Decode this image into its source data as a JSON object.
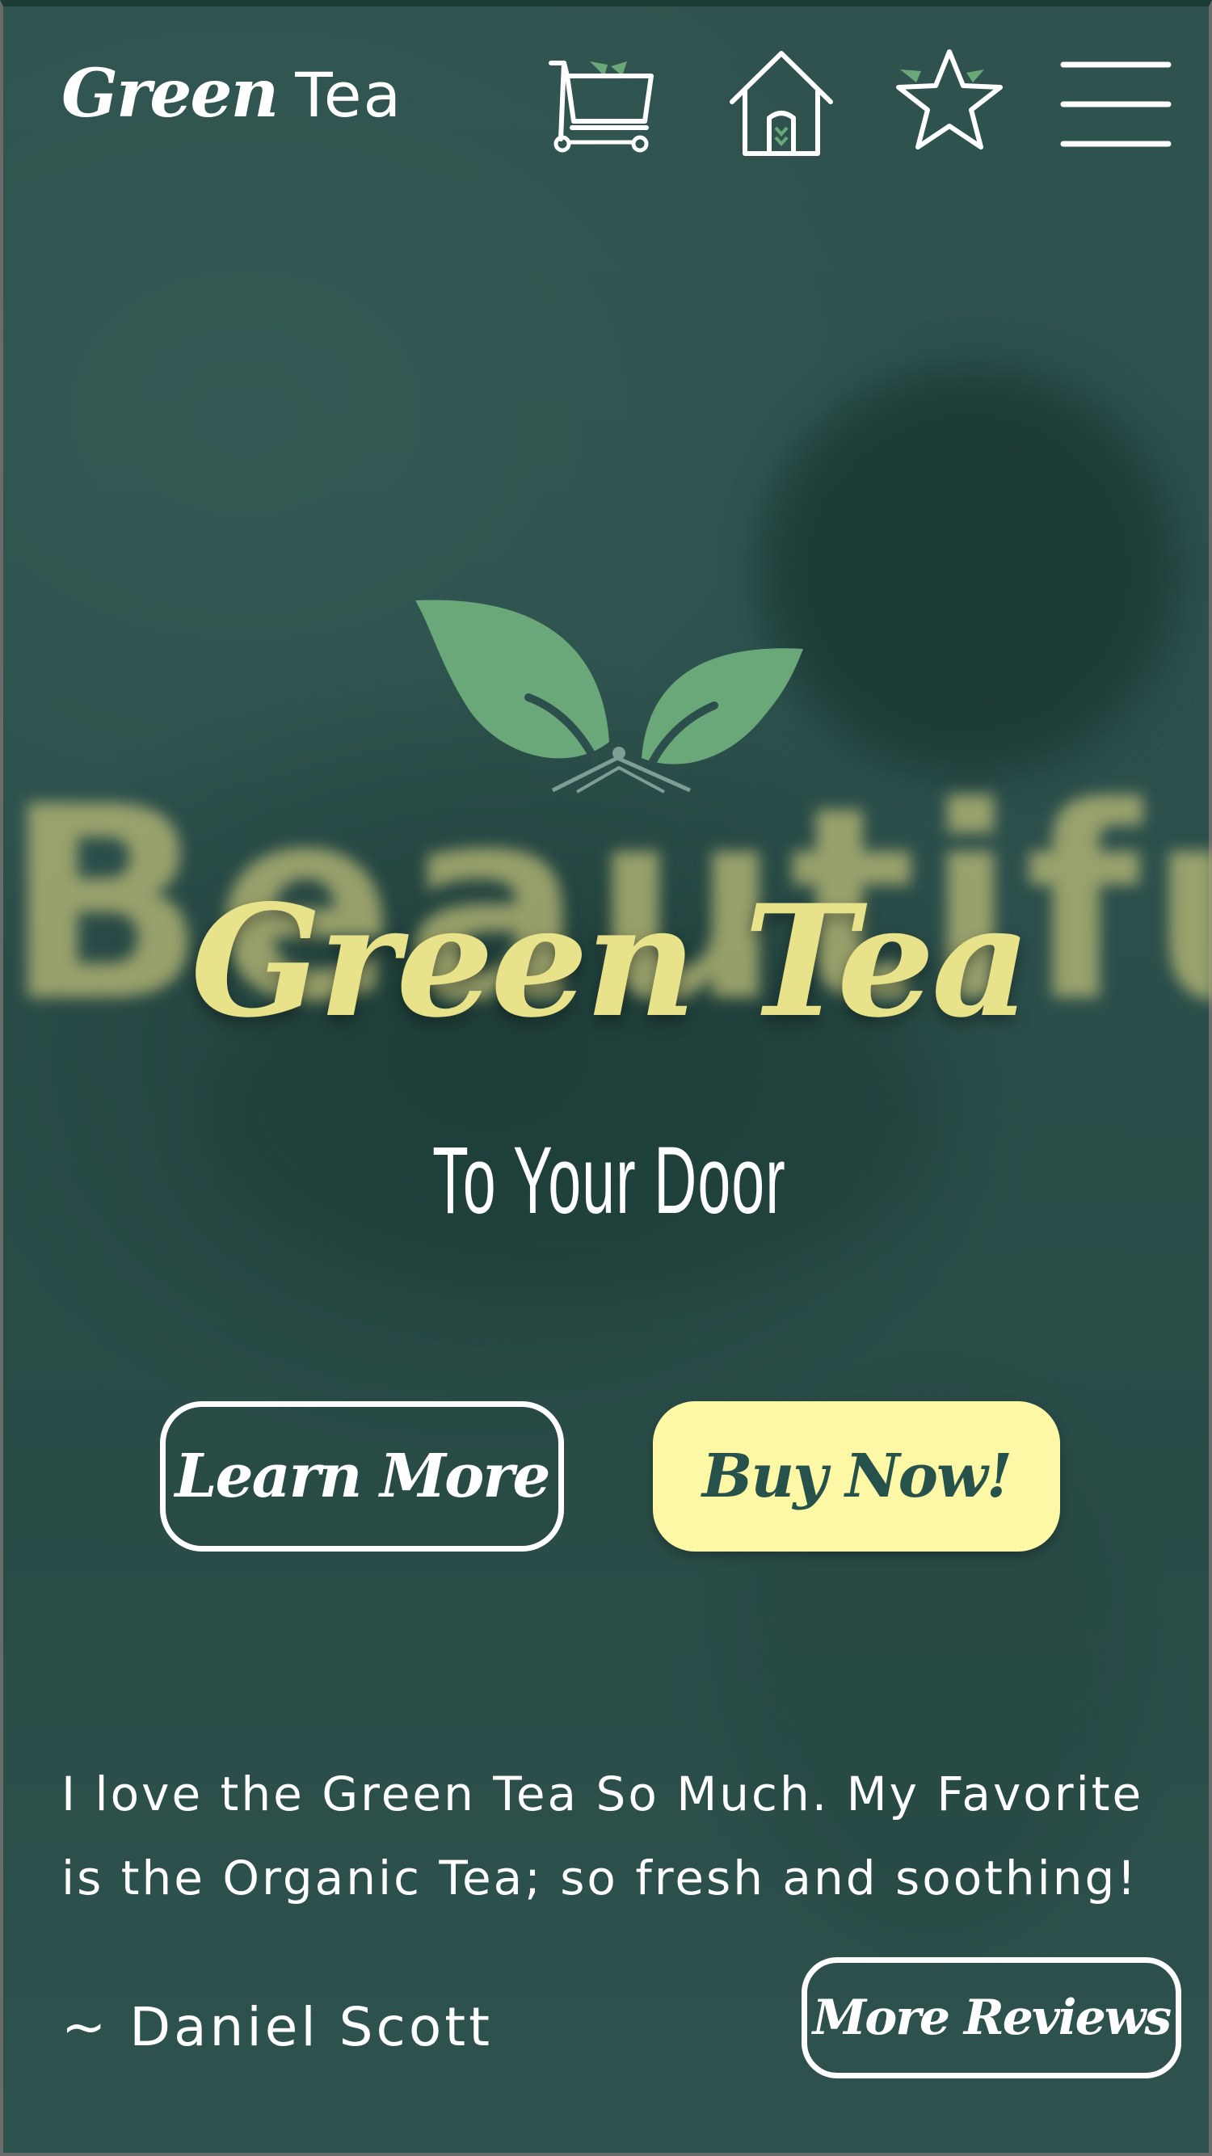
{
  "header": {
    "brand_script": "Green",
    "brand_plain": "Tea",
    "icons": [
      "cart-icon",
      "home-icon",
      "star-icon",
      "menu-icon"
    ]
  },
  "hero": {
    "background_word": "Beautiful",
    "title": "Green Tea",
    "subtitle": "To Your Door",
    "learn_more_label": "Learn More",
    "buy_now_label": "Buy Now!"
  },
  "testimonial": {
    "quote": "I love the Green Tea So Much. My Favorite is the Organic Tea; so fresh and soothing!",
    "author": "~ Daniel Scott",
    "more_reviews_label": "More Reviews"
  },
  "colors": {
    "background": "#2d4f4b",
    "accent_yellow": "#fdf8a6",
    "title_yellow": "#e8e28a",
    "leaf_green": "#6aa87a",
    "button_text_dark": "#27514b"
  }
}
